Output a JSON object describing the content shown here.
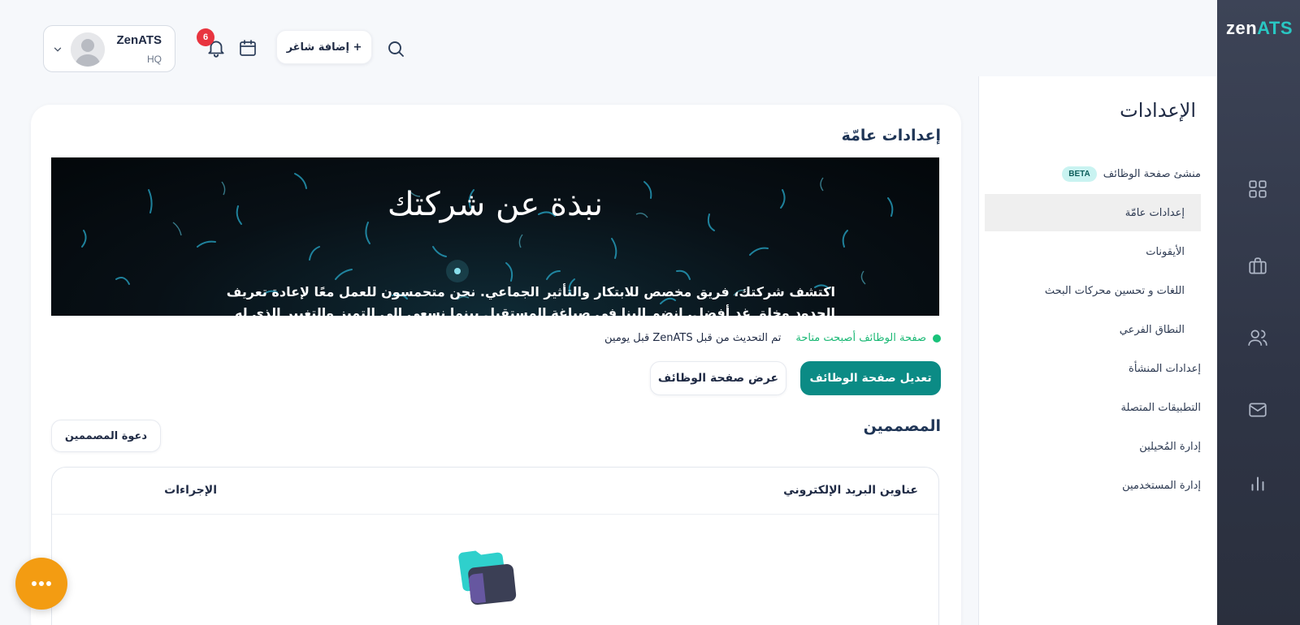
{
  "brand": {
    "logo_zen": "zen",
    "logo_ats": "ATS",
    "accent": "#0b8b85",
    "rail_bg": "#343a4b"
  },
  "rail": {
    "items": [
      {
        "icon": "dashboard-grid-icon"
      },
      {
        "icon": "briefcase-icon"
      },
      {
        "icon": "users-icon"
      },
      {
        "icon": "mail-icon"
      },
      {
        "icon": "analytics-chart-icon"
      }
    ]
  },
  "settings_nav": {
    "title": "الإعدادات",
    "items": [
      {
        "label": "منشئ صفحة الوظائف",
        "badge": "BETA"
      },
      {
        "label": "إعدادات عامّة",
        "active": true
      },
      {
        "label": "الأيقونات"
      },
      {
        "label": "اللغات و تحسين محركات البحث"
      },
      {
        "label": "النطاق الفرعي"
      },
      {
        "label": "إعدادات المنشأة"
      },
      {
        "label": "التطبيقات المتصلة"
      },
      {
        "label": "إدارة المُحيلين"
      },
      {
        "label": "إدارة المستخدمين"
      }
    ]
  },
  "topbar": {
    "user_name": "ZenATS",
    "user_sub": "HQ",
    "notifications_count": "6",
    "add_job_label": "+ إضافة شاغر"
  },
  "general": {
    "title": "إعدادات عامّة",
    "banner_title": "نبذة عن شركتك",
    "banner_text": "اكتشف شركتك، فريق مخصص للابتكار والتأثير الجماعي. نحن متحمسون للعمل معًا لإعادة تعريف الحدود وخلق غدٍ أفضل. انضم إلينا في صياغة المستقبل بينما نسعى إلى التميز والتغيير الذي له معنى.",
    "status_ready": "صفحة الوظائف أصبحت متاحة",
    "status_updated": "تم التحديث من قبل ZenATS قبل يومين",
    "edit_button": "تعديل صفحة الوظائف",
    "view_button": "عرض صفحة الوظائف"
  },
  "designers": {
    "title": "المصممين",
    "invite_button": "دعوة المصممين",
    "columns": [
      "عناوين البريد الإلكتروني",
      "الإجراءات"
    ]
  }
}
